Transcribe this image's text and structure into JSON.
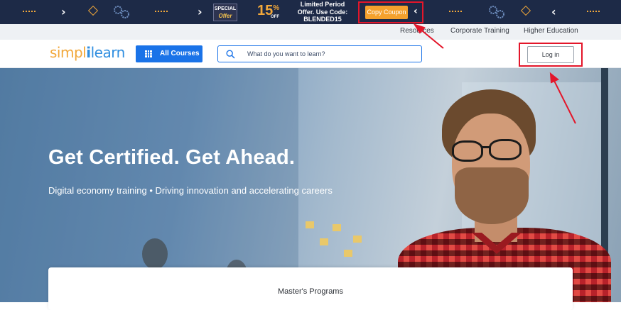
{
  "promo": {
    "special_top": "SPECIAL",
    "special_bottom": "Offer",
    "percent": "15",
    "percent_symbol": "%",
    "off": "OFF",
    "offer_text": "Limited Period Offer. Use Code: BLENDED15",
    "copy_button": "Copy Coupon"
  },
  "topnav": {
    "items": [
      "Resources",
      "Corporate Training",
      "Higher Education"
    ]
  },
  "header": {
    "logo_left": "simpl",
    "logo_bar": "i",
    "logo_right": "learn",
    "all_courses": "All Courses",
    "search_placeholder": "What do you want to learn?",
    "login": "Log in"
  },
  "hero": {
    "title": "Get Certified. Get Ahead.",
    "subtitle": "Digital economy training • Driving innovation and accelerating careers"
  },
  "card": {
    "title": "Master's Programs"
  },
  "colors": {
    "banner_bg": "#1d2a47",
    "accent_orange": "#f5a12d",
    "brand_blue": "#1a73e8",
    "annotation_red": "#e3162a"
  }
}
